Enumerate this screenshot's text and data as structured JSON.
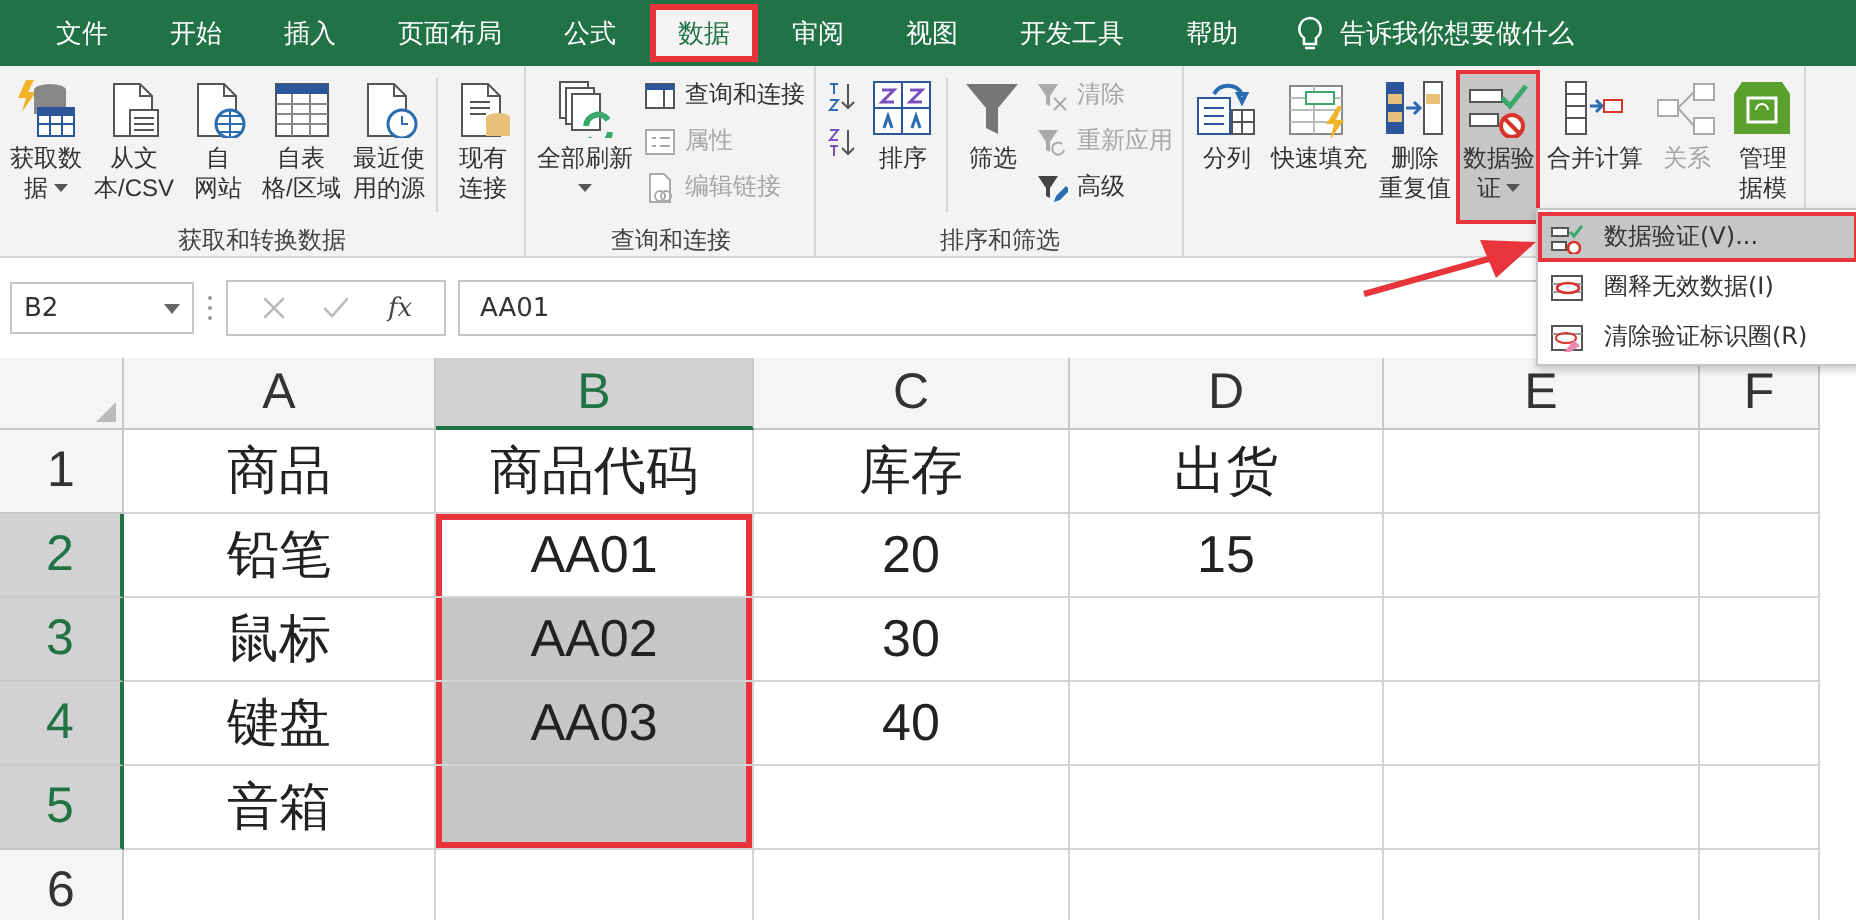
{
  "tabs": [
    {
      "label": "文件",
      "selected": false
    },
    {
      "label": "开始",
      "selected": false
    },
    {
      "label": "插入",
      "selected": false
    },
    {
      "label": "页面布局",
      "selected": false
    },
    {
      "label": "公式",
      "selected": false
    },
    {
      "label": "数据",
      "selected": true,
      "annotated": true
    },
    {
      "label": "审阅",
      "selected": false
    },
    {
      "label": "视图",
      "selected": false
    },
    {
      "label": "开发工具",
      "selected": false
    },
    {
      "label": "帮助",
      "selected": false
    }
  ],
  "tell_me": {
    "placeholder": "告诉我你想要做什么"
  },
  "ribbon": {
    "groups": [
      {
        "label": "获取和转换数据",
        "items": [
          {
            "kind": "large",
            "lines": [
              "获取数",
              "据"
            ],
            "dropdown": true
          },
          {
            "kind": "large",
            "lines": [
              "从文",
              "本/CSV"
            ]
          },
          {
            "kind": "large",
            "lines": [
              "自",
              "网站"
            ]
          },
          {
            "kind": "large",
            "lines": [
              "自表",
              "格/区域"
            ]
          },
          {
            "kind": "large",
            "lines": [
              "最近使",
              "用的源"
            ]
          },
          {
            "kind": "large",
            "lines": [
              "现有",
              "连接"
            ],
            "divider_before": true
          }
        ]
      },
      {
        "label": "查询和连接",
        "items": [
          {
            "kind": "large",
            "lines": [
              "全部刷新"
            ],
            "dropdown": true
          },
          {
            "kind": "stack",
            "items": [
              {
                "label": "查询和连接",
                "disabled": false
              },
              {
                "label": "属性",
                "disabled": true
              },
              {
                "label": "编辑链接",
                "disabled": true
              }
            ]
          }
        ]
      },
      {
        "label": "排序和筛选",
        "items": [
          {
            "kind": "stack",
            "items": [
              {
                "disabled": false
              },
              {
                "disabled": false
              }
            ]
          },
          {
            "kind": "large",
            "lines": [
              "排序"
            ]
          },
          {
            "kind": "large",
            "lines": [
              "筛选"
            ],
            "divider_before": true
          },
          {
            "kind": "stack",
            "items": [
              {
                "label": "清除",
                "disabled": true
              },
              {
                "label": "重新应用",
                "disabled": true
              },
              {
                "label": "高级",
                "disabled": false
              }
            ]
          }
        ]
      },
      {
        "items": [
          {
            "kind": "large",
            "lines": [
              "分列"
            ]
          },
          {
            "kind": "large",
            "lines": [
              "快速填充"
            ]
          },
          {
            "kind": "large",
            "lines": [
              "删除",
              "重复值"
            ]
          },
          {
            "kind": "large",
            "lines": [
              "数据验",
              "证"
            ],
            "dropdown": true,
            "pressed": true,
            "annotated": true
          },
          {
            "kind": "large",
            "lines": [
              "合并计算"
            ]
          },
          {
            "kind": "large",
            "lines": [
              "关系"
            ],
            "disabled": true
          },
          {
            "kind": "large",
            "lines": [
              "管理",
              "据模"
            ]
          }
        ]
      }
    ]
  },
  "formula_bar": {
    "name_box": "B2",
    "function_label": "fx",
    "value": "AA01"
  },
  "menu": {
    "items": [
      {
        "label": "数据验证(V)...",
        "selected": true,
        "annotated": true
      },
      {
        "label": "圈释无效数据(I)",
        "selected": false,
        "annotated": false
      },
      {
        "label": "清除验证标识圈(R)",
        "selected": false,
        "annotated": false
      }
    ]
  },
  "grid": {
    "columns": [
      {
        "label": "A",
        "selected": false
      },
      {
        "label": "B",
        "selected": true
      },
      {
        "label": "C",
        "selected": false
      },
      {
        "label": "D",
        "selected": false
      },
      {
        "label": "E",
        "selected": false
      },
      {
        "label": "F",
        "selected": false
      }
    ],
    "rows": [
      {
        "label": "1",
        "selected": false,
        "cells": [
          {
            "value": "商品",
            "selected": false,
            "annotated": false
          },
          {
            "value": "商品代码",
            "selected": false,
            "annotated": false
          },
          {
            "value": "库存",
            "selected": false,
            "annotated": false
          },
          {
            "value": "出货",
            "selected": false,
            "annotated": false
          }
        ]
      },
      {
        "label": "2",
        "selected": true,
        "cells": [
          {
            "value": "铅笔",
            "selected": false,
            "annotated": false
          },
          {
            "value": "AA01",
            "selected": false,
            "annotated": true
          },
          {
            "value": "20",
            "selected": false,
            "annotated": false
          },
          {
            "value": "15",
            "selected": false,
            "annotated": false
          }
        ]
      },
      {
        "label": "3",
        "selected": true,
        "cells": [
          {
            "value": "鼠标",
            "selected": false,
            "annotated": false
          },
          {
            "value": "AA02",
            "selected": true,
            "annotated": true
          },
          {
            "value": "30",
            "selected": false,
            "annotated": false
          }
        ]
      },
      {
        "label": "4",
        "selected": true,
        "cells": [
          {
            "value": "键盘",
            "selected": false,
            "annotated": false
          },
          {
            "value": "AA03",
            "selected": true,
            "annotated": true
          },
          {
            "value": "40",
            "selected": false,
            "annotated": false
          }
        ]
      },
      {
        "label": "5",
        "selected": true,
        "cells": [
          {
            "value": "音箱",
            "selected": false,
            "annotated": false
          },
          {
            "selected": true,
            "annotated": true
          }
        ]
      },
      {
        "label": "6",
        "selected": false
      }
    ]
  }
}
